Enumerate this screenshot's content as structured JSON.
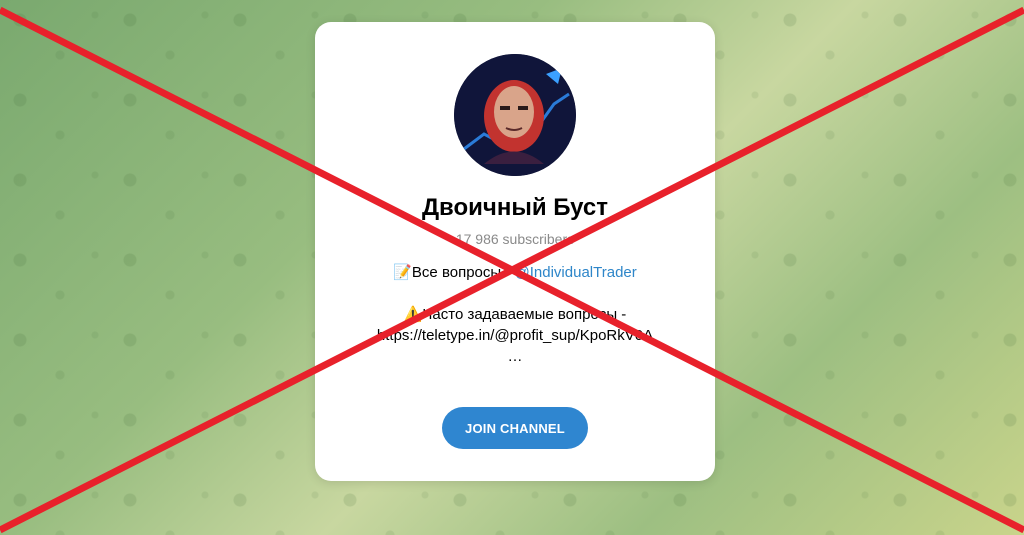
{
  "channel": {
    "title": "Двоичный Буст",
    "subscribers": "17 986 subscribers",
    "description": {
      "line1_prefix": "📝Все вопросы - ",
      "line1_link": "@IndividualTrader",
      "line3": "⚠️Часто задаваемые вопросы -",
      "line4": "https://teletype.in/@profit_sup/KpoRkV0A",
      "line5": "…"
    },
    "join_label": "JOIN CHANNEL"
  },
  "overlay": {
    "cross_color": "#e8212b"
  },
  "icons": {
    "avatar": "portrait-avatar-icon"
  }
}
